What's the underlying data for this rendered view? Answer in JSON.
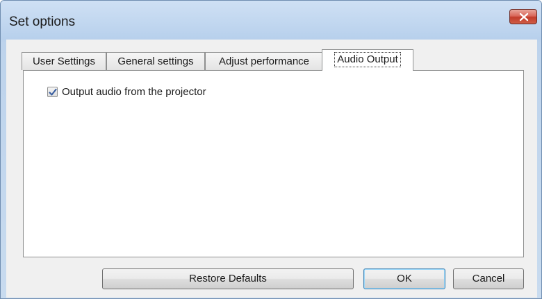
{
  "window": {
    "title": "Set options"
  },
  "tabs": [
    {
      "label": "User Settings",
      "active": false
    },
    {
      "label": "General settings",
      "active": false
    },
    {
      "label": "Adjust performance",
      "active": false
    },
    {
      "label": "Audio Output",
      "active": true
    }
  ],
  "panel": {
    "checkbox": {
      "label": "Output audio from the projector",
      "checked": true
    }
  },
  "buttons": {
    "restore_defaults": "Restore Defaults",
    "ok": "OK",
    "cancel": "Cancel"
  },
  "colors": {
    "titlebar": "#b7d0ec",
    "close_button": "#c23c2b",
    "default_button_border": "#3c7fb1"
  }
}
